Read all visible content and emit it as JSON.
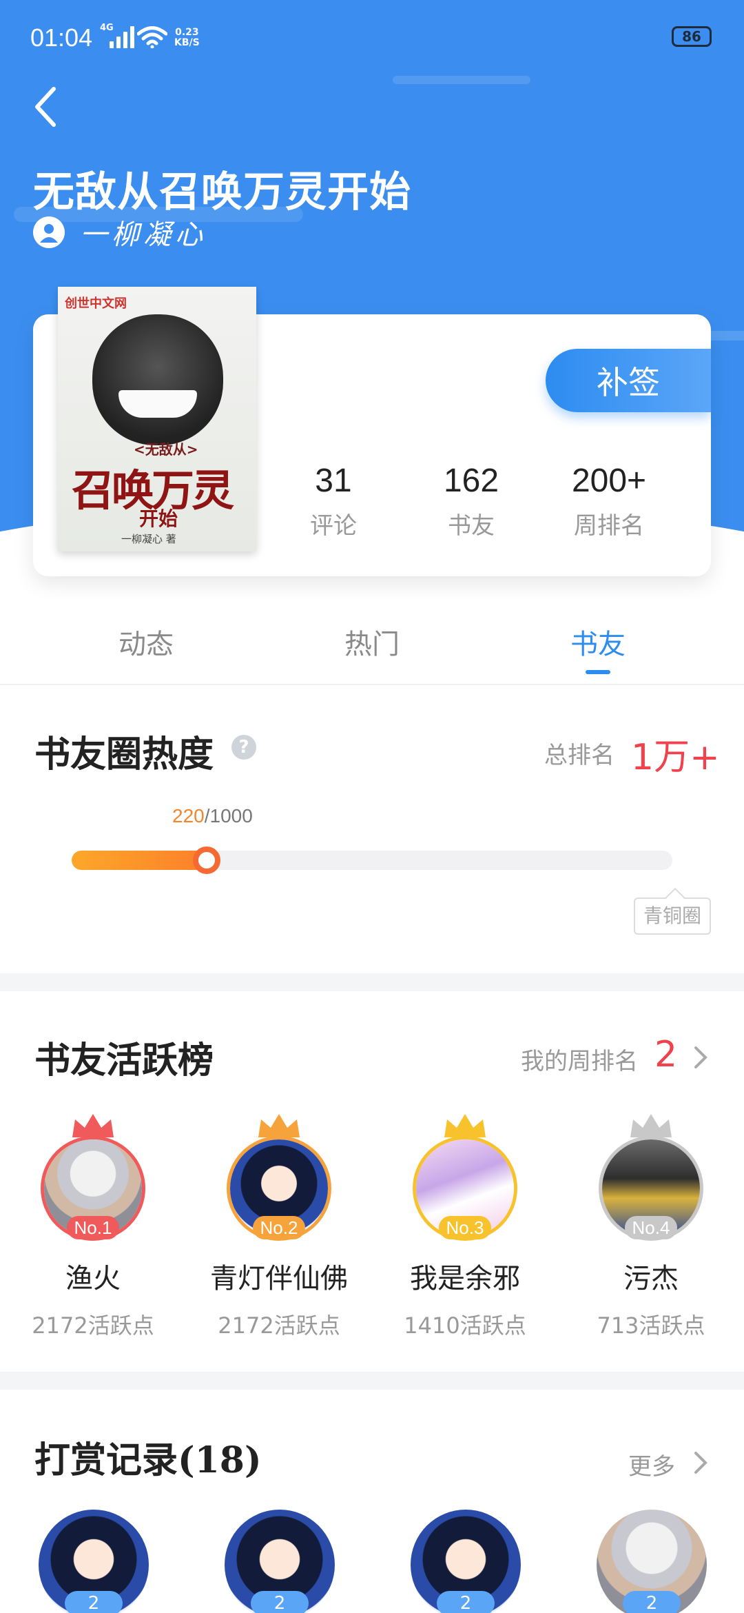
{
  "status": {
    "time": "01:04",
    "network": "4G",
    "speed_value": "0.23",
    "speed_unit": "KB/S",
    "battery": "86"
  },
  "header": {
    "title": "无敌从召唤万灵开始",
    "author": "一柳凝心"
  },
  "cover": {
    "publisher": "创世中文网",
    "small_title": "<无敌从>",
    "main_title": "召唤万灵",
    "sub_title": "开始",
    "author_line": "一柳凝心 著"
  },
  "book": {
    "checkin_label": "补签"
  },
  "stats": [
    {
      "value": "31",
      "label": "评论"
    },
    {
      "value": "162",
      "label": "书友"
    },
    {
      "value": "200+",
      "label": "周排名"
    }
  ],
  "tabs": [
    {
      "label": "动态",
      "active": false
    },
    {
      "label": "热门",
      "active": false
    },
    {
      "label": "书友",
      "active": true
    }
  ],
  "heat": {
    "title": "书友圈热度",
    "help": "?",
    "rank_label": "总排名",
    "rank_value": "1万+",
    "current": "220",
    "total": "/1000",
    "progress": 0.22,
    "level": "青铜圈"
  },
  "activity": {
    "title": "书友活跃榜",
    "my_rank_label": "我的周排名",
    "my_rank_value": "2",
    "members": [
      {
        "rank": "No.1",
        "name": "渔火",
        "points": "2172活跃点",
        "color": "#f05a5a"
      },
      {
        "rank": "No.2",
        "name": "青灯伴仙佛",
        "points": "2172活跃点",
        "color": "#f7a33b"
      },
      {
        "rank": "No.3",
        "name": "我是余邪",
        "points": "1410活跃点",
        "color": "#f7c22b"
      },
      {
        "rank": "No.4",
        "name": "污杰",
        "points": "713活跃点",
        "color": "#c8c8c8"
      }
    ]
  },
  "tips": {
    "title": "打赏记录(18)",
    "more_label": "更多",
    "levels": [
      "2",
      "2",
      "2",
      "2"
    ]
  },
  "colors": {
    "primary": "#2d8cf0",
    "header_bg": "#3b8ef0",
    "accent_red": "#f0424c",
    "accent_orange": "#fb7d2a"
  }
}
